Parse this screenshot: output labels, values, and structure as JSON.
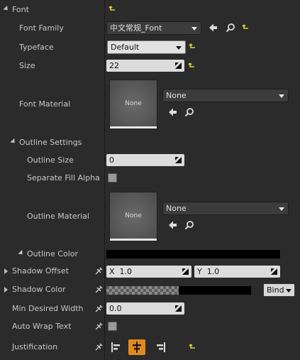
{
  "colors": {
    "accent_orange": "#e08a1e",
    "reset_yellow": "#d7d33a",
    "background": "#2b2b2b"
  },
  "font": {
    "section_label": "Font",
    "family": {
      "label": "Font Family",
      "value": "中文常规_Font"
    },
    "typeface": {
      "label": "Typeface",
      "value": "Default"
    },
    "size": {
      "label": "Size",
      "value": "22"
    },
    "material": {
      "label": "Font Material",
      "thumb_text": "None",
      "value": "None"
    },
    "outline": {
      "section_label": "Outline Settings",
      "size": {
        "label": "Outline Size",
        "value": "0"
      },
      "separate_fill_alpha": {
        "label": "Separate Fill Alpha",
        "checked": false
      },
      "material": {
        "label": "Outline Material",
        "thumb_text": "None",
        "value": "None"
      },
      "color": {
        "label": "Outline Color"
      }
    }
  },
  "shadow_offset": {
    "label": "Shadow Offset",
    "x_label": "X",
    "x_value": "1.0",
    "y_label": "Y",
    "y_value": "1.0"
  },
  "shadow_color": {
    "label": "Shadow Color",
    "bind_label": "Bind"
  },
  "min_desired_width": {
    "label": "Min Desired Width",
    "value": "0.0"
  },
  "auto_wrap_text": {
    "label": "Auto Wrap Text",
    "checked": false
  },
  "justification": {
    "label": "Justification",
    "options": [
      "left",
      "center",
      "right"
    ],
    "selected": "center"
  }
}
